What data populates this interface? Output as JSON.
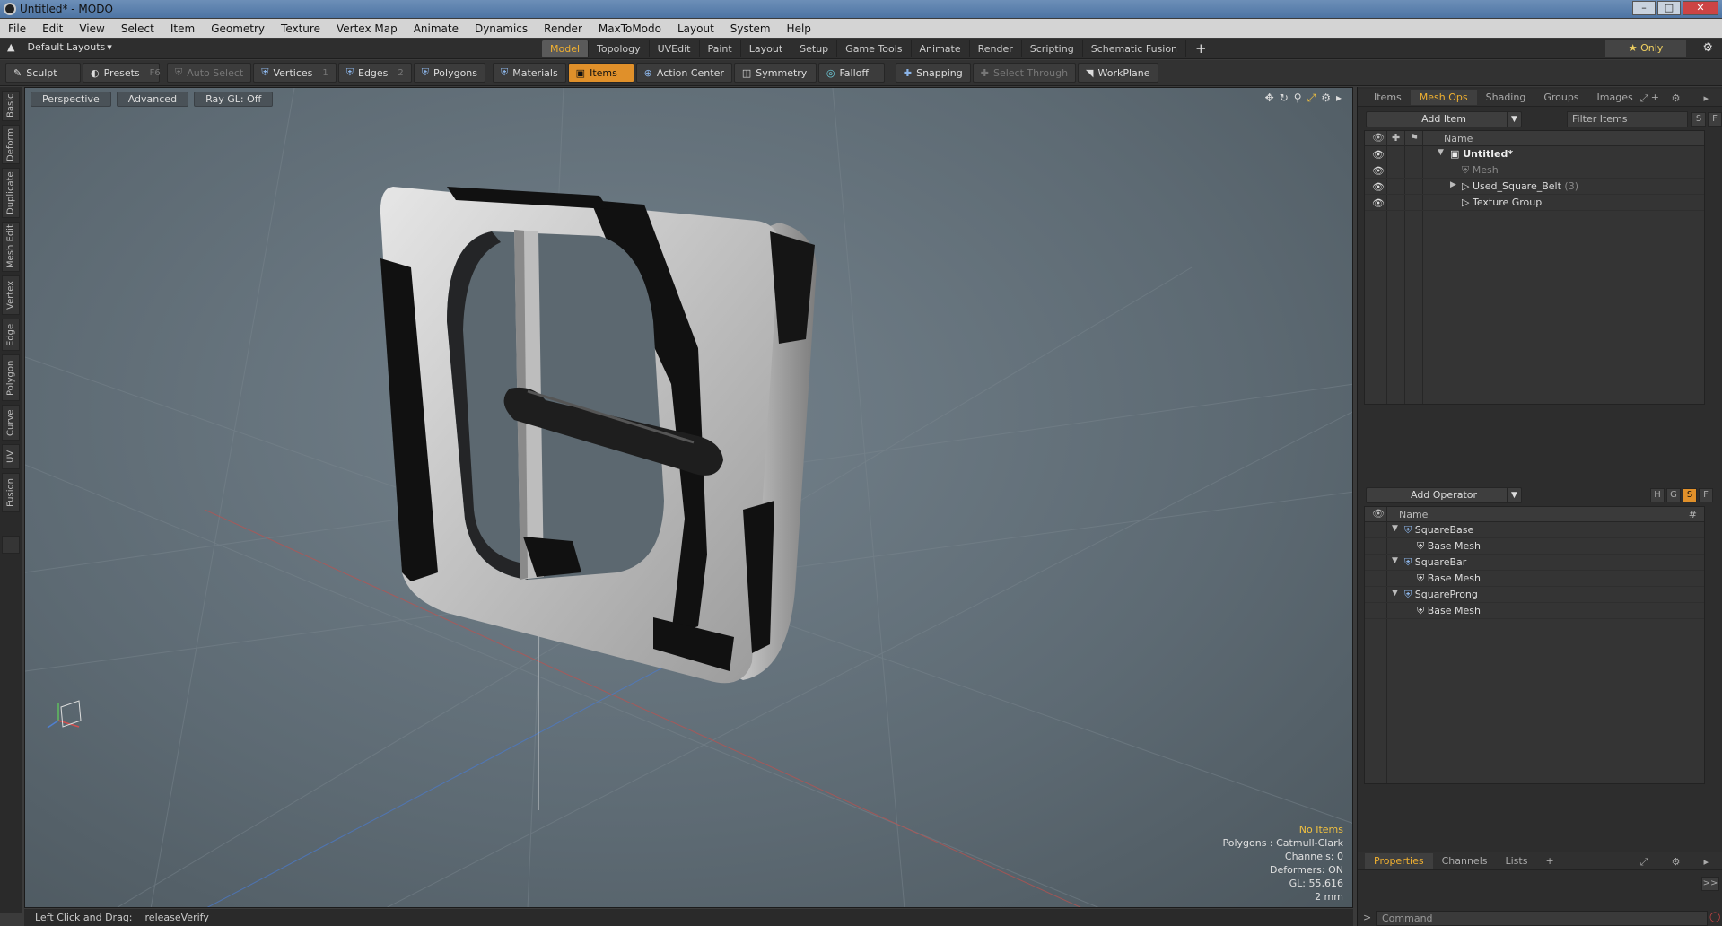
{
  "window": {
    "title": "Untitled* - MODO"
  },
  "menu": [
    "File",
    "Edit",
    "View",
    "Select",
    "Item",
    "Geometry",
    "Texture",
    "Vertex Map",
    "Animate",
    "Dynamics",
    "Render",
    "MaxToModo",
    "Layout",
    "System",
    "Help"
  ],
  "layout_bar": {
    "default_layouts": "Default Layouts",
    "tabs": [
      "Model",
      "Topology",
      "UVEdit",
      "Paint",
      "Layout",
      "Setup",
      "Game Tools",
      "Animate",
      "Render",
      "Scripting",
      "Schematic Fusion"
    ],
    "active_tab": "Model",
    "only_label": "Only"
  },
  "toolbar": {
    "sculpt": "Sculpt",
    "presets": "Presets",
    "presets_key": "F6",
    "auto_select": "Auto Select",
    "vertices": "Vertices",
    "vertices_key": "1",
    "edges": "Edges",
    "edges_key": "2",
    "polygons": "Polygons",
    "materials": "Materials",
    "items": "Items",
    "action_center": "Action Center",
    "symmetry": "Symmetry",
    "falloff": "Falloff",
    "snapping": "Snapping",
    "select_through": "Select Through",
    "workplane": "WorkPlane"
  },
  "left_tabs": [
    "Basic",
    "Deform",
    "Duplicate",
    "Mesh Edit",
    "Vertex",
    "Edge",
    "Polygon",
    "Curve",
    "UV",
    "Fusion"
  ],
  "viewport": {
    "view_mode": "Perspective",
    "advanced": "Advanced",
    "raygl": "Ray GL: Off",
    "info": {
      "selection": "No Items",
      "polygons": "Polygons : Catmull-Clark",
      "channels": "Channels: 0",
      "deformers": "Deformers: ON",
      "gl": "GL: 55,616",
      "scale": "2 mm"
    }
  },
  "status": {
    "hint_label": "Left Click and Drag:",
    "hint_value": "releaseVerify"
  },
  "items_panel": {
    "tabs": [
      "Items",
      "Mesh Ops",
      "Shading",
      "Groups",
      "Images"
    ],
    "active_tab": "Mesh Ops",
    "add_item": "Add Item",
    "filter_placeholder": "Filter Items",
    "name_header": "Name",
    "tree": [
      {
        "label": "Untitled*",
        "count": ""
      },
      {
        "label": "Mesh",
        "count": ""
      },
      {
        "label": "Used_Square_Belt",
        "count": "(3)"
      },
      {
        "label": "Texture Group",
        "count": ""
      }
    ]
  },
  "meshops_panel": {
    "add_operator": "Add Operator",
    "name_header": "Name",
    "hash_header": "#",
    "flags": [
      "H",
      "G",
      "S",
      "F"
    ],
    "tree": [
      {
        "label": "SquareBase"
      },
      {
        "label": "Base Mesh"
      },
      {
        "label": "SquareBar"
      },
      {
        "label": "Base Mesh"
      },
      {
        "label": "SquareProng"
      },
      {
        "label": "Base Mesh"
      }
    ]
  },
  "bottom_panel": {
    "tabs": [
      "Properties",
      "Channels",
      "Lists"
    ],
    "active_tab": "Properties",
    "command_placeholder": "Command",
    "expand_label": ">>"
  },
  "colors": {
    "accent": "#e0902a",
    "viewport_bg": "#62707a",
    "panel_bg": "#2d2d2d"
  }
}
